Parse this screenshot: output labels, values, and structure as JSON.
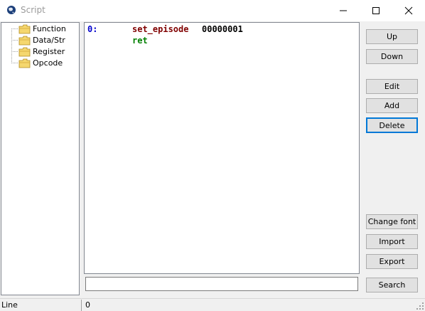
{
  "window": {
    "title": "Script"
  },
  "tree": {
    "items": [
      {
        "label": "Function"
      },
      {
        "label": "Data/Str"
      },
      {
        "label": "Register"
      },
      {
        "label": "Opcode"
      }
    ]
  },
  "editor": {
    "lines": [
      {
        "number": "0:",
        "command": "set_episode",
        "argument": "00000001"
      },
      {
        "command": "ret"
      }
    ],
    "colors": {
      "line_number": "#0000cc",
      "command": "#800000",
      "ret": "#008000",
      "argument": "#000000"
    }
  },
  "buttons": {
    "up": "Up",
    "down": "Down",
    "edit": "Edit",
    "add": "Add",
    "delete": "Delete",
    "change_font": "Change font",
    "import": "Import",
    "export": "Export",
    "search": "Search"
  },
  "search": {
    "value": ""
  },
  "statusbar": {
    "label": "Line",
    "value": "0"
  }
}
